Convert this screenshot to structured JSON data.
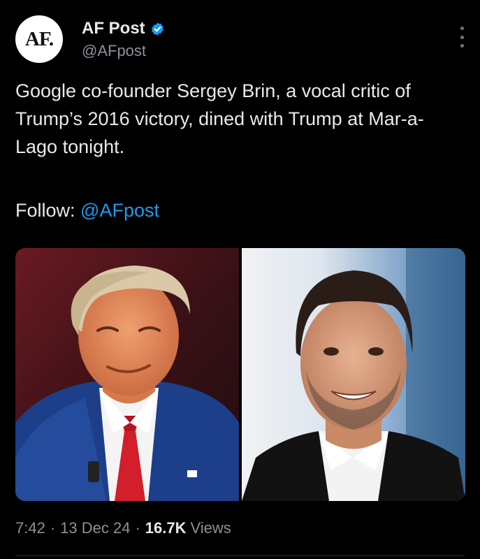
{
  "post": {
    "avatar_text": "AF.",
    "display_name": "AF Post",
    "handle": "@AFpost",
    "text": "Google co-founder Sergey Brin, a vocal critic of Trump’s 2016 victory, dined with Trump at Mar-a-Lago tonight.",
    "follow_label": "Follow: ",
    "follow_mention": "@AFpost",
    "time": "7:42",
    "date": "13 Dec 24",
    "views_count": "16.7K",
    "views_label": "Views"
  },
  "colors": {
    "background": "#000000",
    "text": "#e7e9ea",
    "secondary_text": "#8b9299",
    "link": "#1d9bf0",
    "verified_badge": "#1d9bf0"
  },
  "icons": {
    "verified": "verified-badge-icon",
    "more": "more-options-icon"
  }
}
